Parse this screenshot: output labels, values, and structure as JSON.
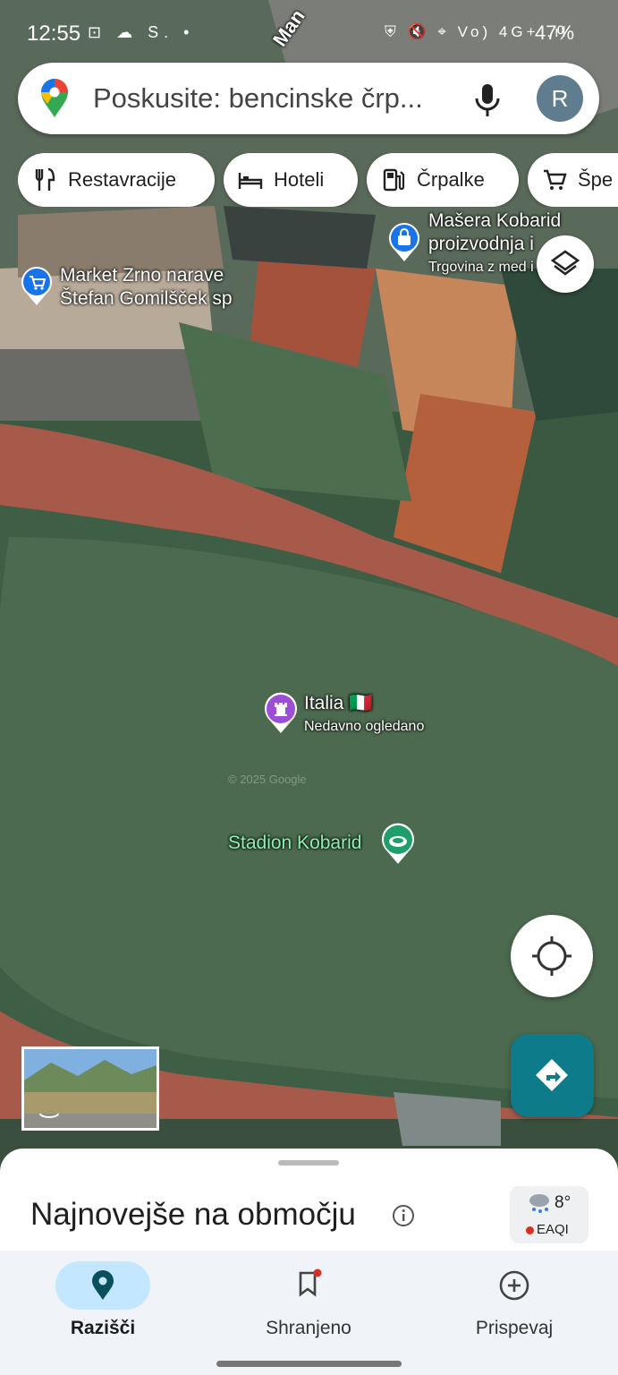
{
  "status_bar": {
    "time": "12:55",
    "left_icons_text": "⊡ ☁ S. •",
    "right_icons_text": "⛨ 🔇 ⌖ Vo) 4G+ .ıl",
    "battery": "47%"
  },
  "search": {
    "placeholder": "Poskusite: bencinske črp...",
    "avatar_letter": "R"
  },
  "chips": [
    {
      "label": "Restavracije",
      "icon": "fork-knife-icon"
    },
    {
      "label": "Hoteli",
      "icon": "bed-icon"
    },
    {
      "label": "Črpalke",
      "icon": "fuel-pump-icon"
    },
    {
      "label": "Špe",
      "icon": "cart-icon"
    }
  ],
  "map": {
    "street_top": "Man",
    "street_partial": "Manj ..................",
    "pois": {
      "market": {
        "line1": "Market Zrno narave",
        "line2": "Štefan Gomilšček sp"
      },
      "masera": {
        "line1": "Mašera Kobarid",
        "line2": "proizvodnja i",
        "sub": "Trgovina z med       i pr"
      },
      "italia": {
        "name": "Italia 🇮🇹",
        "sub": "Nedavno ogledano"
      },
      "stadion": {
        "name": "Stadion Kobarid"
      }
    },
    "watermark": "© 2025 Google"
  },
  "sheet": {
    "title": "Najnovejše na območju",
    "weather_temp": "8°",
    "weather_aqi": "EAQI"
  },
  "nav": {
    "items": [
      {
        "label": "Razišči",
        "icon": "location-pin-icon",
        "active": true
      },
      {
        "label": "Shranjeno",
        "icon": "bookmark-icon",
        "active": false
      },
      {
        "label": "Prispevaj",
        "icon": "add-circle-icon",
        "active": false
      }
    ]
  },
  "colors": {
    "accent_teal": "#0d7b8a",
    "nav_active_pill": "#c2e7ff",
    "italia_pin": "#9c4fd6",
    "stadion_pin": "#1e9e6a",
    "shop_pin": "#1a73e8"
  }
}
